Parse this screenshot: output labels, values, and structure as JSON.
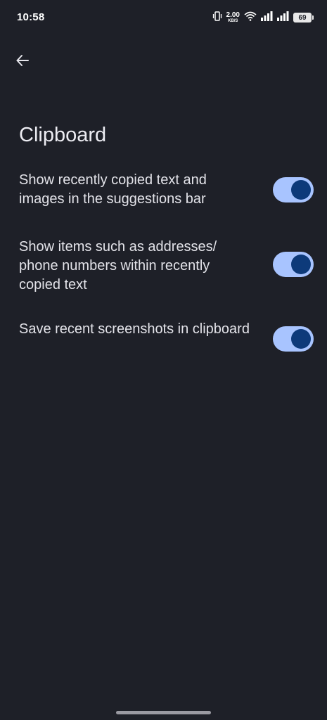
{
  "status_bar": {
    "time": "10:58",
    "net_speed_value": "2.00",
    "net_speed_unit": "KB/S",
    "battery_level": "69",
    "icons": [
      "vibrate-icon",
      "wifi-icon",
      "signal-icon",
      "signal-icon",
      "battery-icon"
    ]
  },
  "header": {
    "back_icon": "arrow-left-icon",
    "title": "Clipboard"
  },
  "settings": [
    {
      "label": "Show recently copied text and images in the suggestions bar",
      "enabled": true
    },
    {
      "label": "Show items such as addresses/ phone numbers within recently copied text",
      "enabled": true
    },
    {
      "label": "Save recent screenshots in clipboard",
      "enabled": true
    }
  ],
  "colors": {
    "background": "#1e2028",
    "toggle_track_on": "#a8c4ff",
    "toggle_knob_on": "#0d3a7a"
  }
}
